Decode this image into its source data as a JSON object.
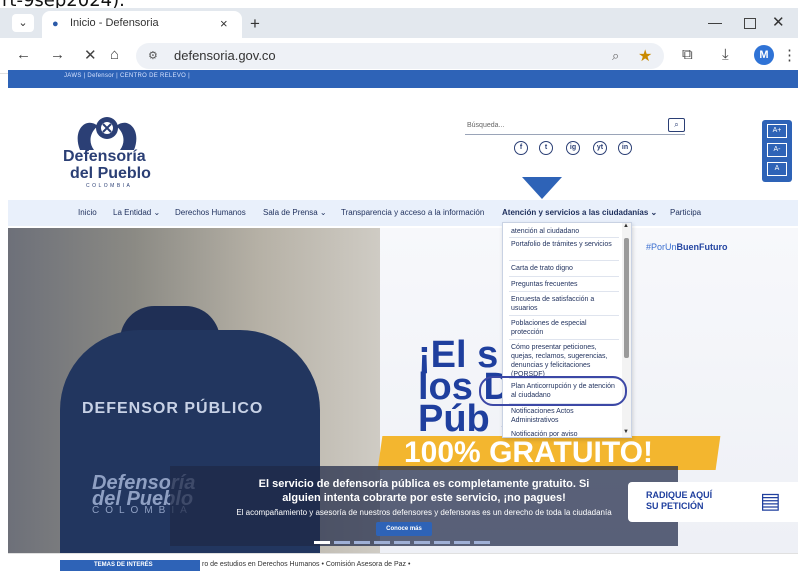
{
  "caption": "rt-9sep2024).",
  "browser": {
    "tab_title": "Inicio - Defensoria",
    "tab_close": "×",
    "new_tab": "+",
    "url": "defensoria.gov.co",
    "avatar": "M",
    "window_min": "—",
    "window_close": "✕"
  },
  "site_bar": "JAWS  |  Defensor  |  CENTRO DE RELEVO  |",
  "logo": {
    "line1": "Defensoría",
    "line2": "del Pueblo",
    "country": "COLOMBIA"
  },
  "search": {
    "placeholder": "Búsqueda..."
  },
  "social": [
    "f",
    "t",
    "ig",
    "yt",
    "in"
  ],
  "a11y": [
    "A+",
    "A-",
    "A"
  ],
  "nav": [
    "Inicio",
    "La Entidad ⌄",
    "Derechos Humanos",
    "Sala de Prensa ⌄",
    "Transparencia y acceso a la información",
    "Atención y servicios a las ciudadanías ⌄",
    "Participa"
  ],
  "dropdown": [
    "atención al ciudadano",
    "Portafolio de trámites y servicios",
    "Carta de trato digno",
    "Preguntas frecuentes",
    "Encuesta de satisfacción a usuarios",
    "Poblaciones de especial protección",
    "Cómo presentar peticiones, quejas, reclamos, sugerencias, denuncias y felicitaciones (PQRSDF)",
    "Plan Anticorrupción y de atención al ciudadano",
    "Notificaciones Actos Administrativos",
    "Notificación por aviso"
  ],
  "hero": {
    "hashtag_prefix": "#PorUn",
    "hashtag_bold": "BuenFuturo",
    "big_line1": "¡El s          de",
    "big_line2": "los D          ores",
    "big_line3": "Púb           s",
    "gratuito": "100% GRATUITO!",
    "jacket_text": "DEFENSOR PÚBLICO",
    "jacket_logo1": "Defensoría",
    "jacket_logo2": "del Pueblo",
    "jacket_logo3": "COLOMBIA",
    "caption_l1": "El servicio de defensoría pública es completamente gratuito. Si",
    "caption_l2": "alguien intenta cobrarte por este servicio, ¡no pagues!",
    "caption_l3": "El acompañamiento y asesoría de nuestros defensores y defensoras es un derecho de toda la ciudadanía",
    "conoce_button": "Conoce más",
    "radique_l1": "RADIQUE AQUÍ",
    "radique_l2": "SU PETICIÓN"
  },
  "footer": {
    "temas": "TEMAS DE INTERÉS",
    "ticker": "ro de estudios en Derechos Humanos  •  Comisión Asesora de Paz  •"
  },
  "colors": {
    "brand_blue": "#2e63b7",
    "navy": "#1e2f5c",
    "gold": "#f3b62f",
    "highlight": "#3c48a6"
  }
}
